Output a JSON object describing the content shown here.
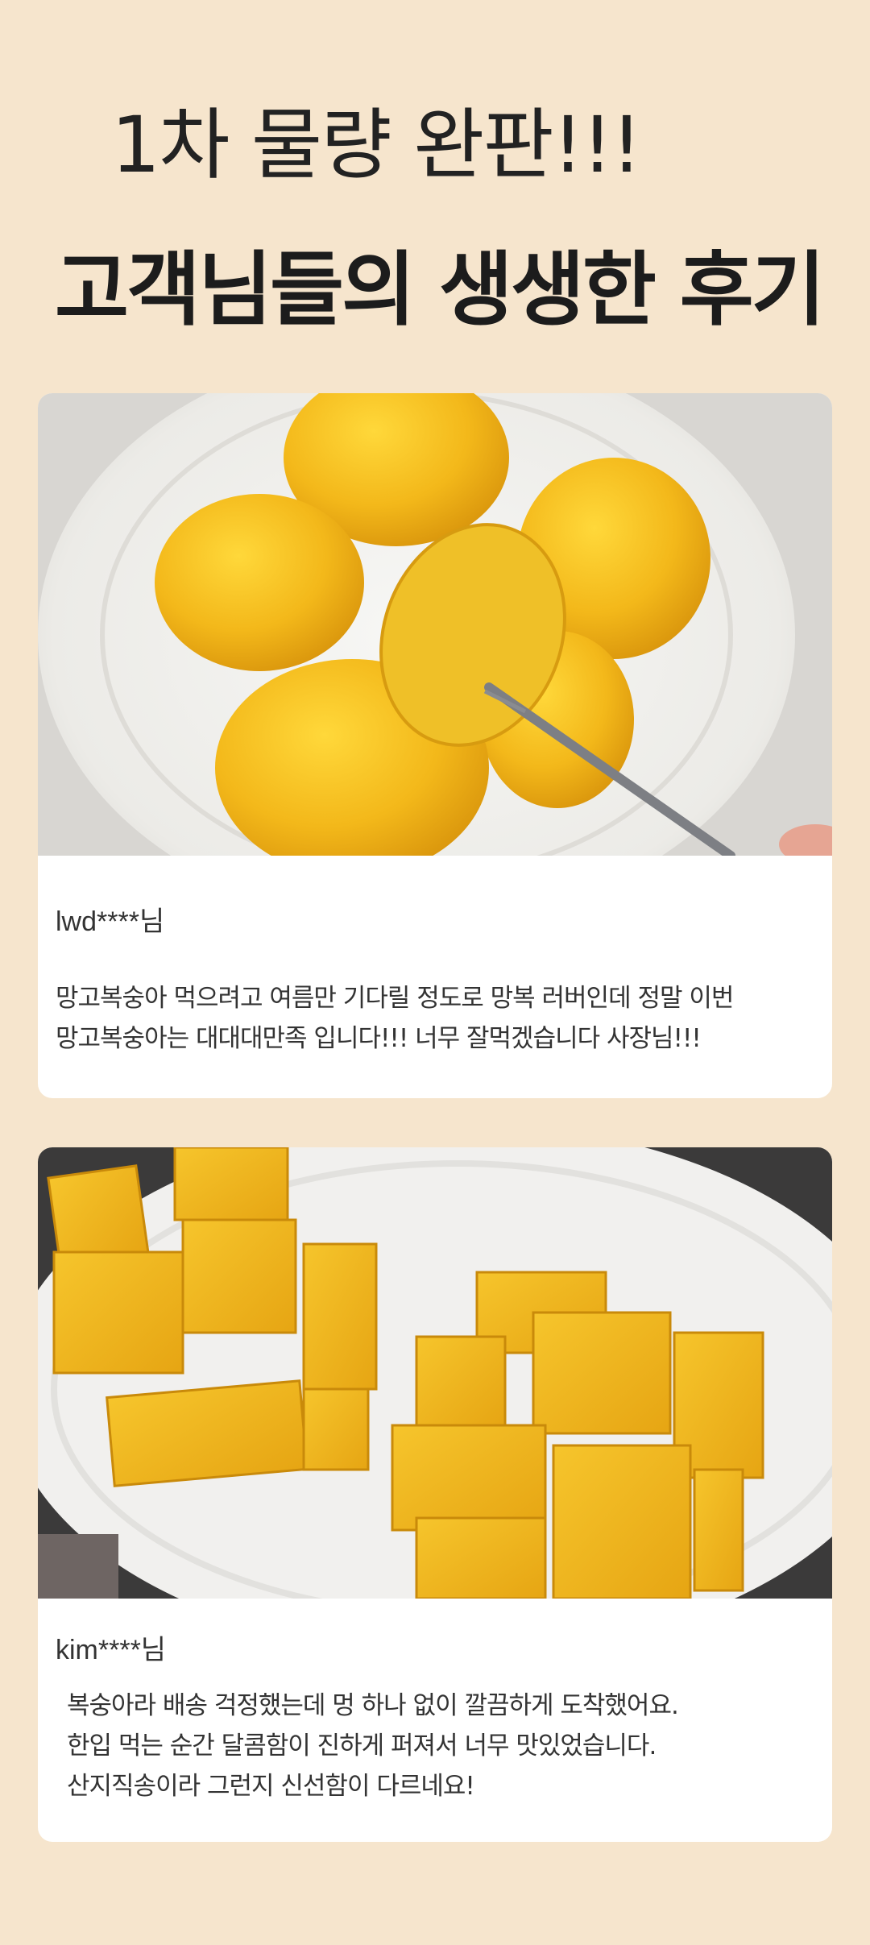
{
  "header": {
    "subtitle": "1차 물량 완판!!!",
    "title": "고객님들의 생생한 후기"
  },
  "reviews": [
    {
      "username": "lwd****님",
      "photo_description_icon": "peeled-peaches-on-plate-photo",
      "lines": [
        "망고복숭아 먹으려고 여름만 기다릴 정도로 망복 러버인데 정말 이번",
        "망고복숭아는 대대대만족 입니다!!! 너무 잘먹겠습니다 사장님!!!"
      ]
    },
    {
      "username": "kim****님",
      "photo_description_icon": "cubed-mango-on-plate-photo",
      "lines": [
        "복숭아라 배송 걱정했는데 멍 하나 없이 깔끔하게 도착했어요.",
        "한입 먹는 순간 달콤함이 진하게 퍼져서 너무 맛있었습니다.",
        "산지직송이라 그런지 신선함이 다르네요!"
      ]
    }
  ],
  "colors": {
    "background": "#f6e5cd",
    "card": "#ffffff",
    "text": "#1f1f1f"
  }
}
